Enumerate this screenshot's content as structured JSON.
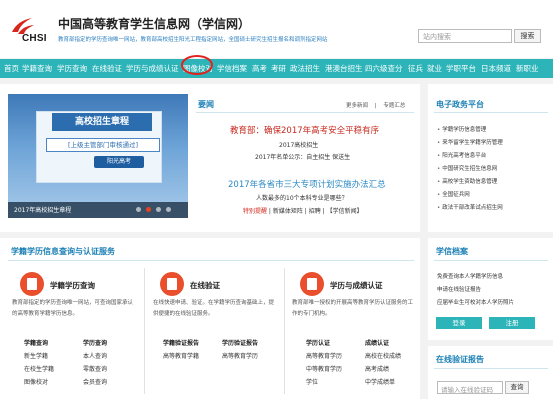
{
  "header": {
    "logo_text": "CHSI",
    "title": "中国高等教育学生信息网（学信网）",
    "subtitle": "教育部指定的学历查询唯一网站，教育部高校招生阳光工程指定网站，全国硕士研究生招生报名和调剂指定网站",
    "search_placeholder": "站内搜索",
    "search_button": "搜索"
  },
  "nav": {
    "items": [
      "首页",
      "学籍查询",
      "学历查询",
      "在线验证",
      "学历与成绩认证",
      "图像校对",
      "学信档案",
      "高考",
      "考研",
      "政法招生",
      "港澳台招生",
      "四六级查分",
      "征兵",
      "就业",
      "学职平台",
      "日本频道",
      "新职业"
    ],
    "highlighted": "图像校对"
  },
  "banner": {
    "title": "高校招生章程",
    "tag": "[上级主管部门审核通过]",
    "stamp": "阳光高考",
    "caption": "2017年高校招生章程",
    "slide_count": 4,
    "active_slide": 1
  },
  "news": {
    "heading": "要闻",
    "more_link": "更多新闻",
    "special_link": "专题汇总",
    "sep": "|",
    "headline": "教育部：确保2017年高考安全平稳有序",
    "items": [
      "2017高校招生",
      "2017年名单公示：自主招生 保送生"
    ],
    "headline2": "2017年各省市三大专项计划实施办法汇总",
    "item3": "人数最多的10个本科专业是哪些？",
    "links": [
      "特别提醒",
      "新媒体矩阵",
      "招聘",
      "【学信新闻】"
    ]
  },
  "eservice": {
    "heading": "电子政务平台",
    "items": [
      "学籍学历信息管理",
      "来华留学生学籍学历管理",
      "阳光高考信息平台",
      "中国研究生招生信息网",
      "高校学生资助信息管理",
      "全国征兵网",
      "政法干部改革试点招生网"
    ]
  },
  "services": {
    "heading": "学籍学历信息查询与认证服务",
    "cards": [
      {
        "title": "学籍学历查询",
        "desc": "教育部指定的学历查询唯一网站，可查询国家承认的高等教育学籍学历信息。",
        "cols": [
          {
            "head": "学籍查询",
            "items": [
              "新生学籍",
              "在校生学籍",
              "图像校对"
            ]
          },
          {
            "head": "学历查询",
            "items": [
              "本人查询",
              "零散查询",
              "会员查询"
            ]
          }
        ]
      },
      {
        "title": "在线验证",
        "desc": "在线快速申请、验证。在学籍学历查询基础上，提供便捷的在线验证服务。",
        "cols": [
          {
            "head": "学籍验证报告",
            "items": [
              "高等教育学籍"
            ]
          },
          {
            "head": "学历验证报告",
            "items": [
              "高等教育学历"
            ]
          }
        ]
      },
      {
        "title": "学历与成绩认证",
        "desc": "教育部唯一授权的开展高等教育学历认证服务的工作的专门机构。",
        "cols": [
          {
            "head": "学历认证",
            "items": [
              "高等教育学历",
              "中等教育学历",
              "学位"
            ]
          },
          {
            "head": "成绩认证",
            "items": [
              "高校在校成绩",
              "高考成绩",
              "中学成绩单"
            ]
          }
        ]
      }
    ]
  },
  "archive": {
    "heading": "学信档案",
    "items": [
      "免费查询本人学籍学历信息",
      "申请在线验证报告",
      "应届毕业生可校对本人学历照片"
    ],
    "register_button": "登录",
    "signup_button": "注册"
  },
  "verify": {
    "heading": "在线验证报告",
    "placeholder": "请输入在线验证码",
    "button": "查询"
  }
}
